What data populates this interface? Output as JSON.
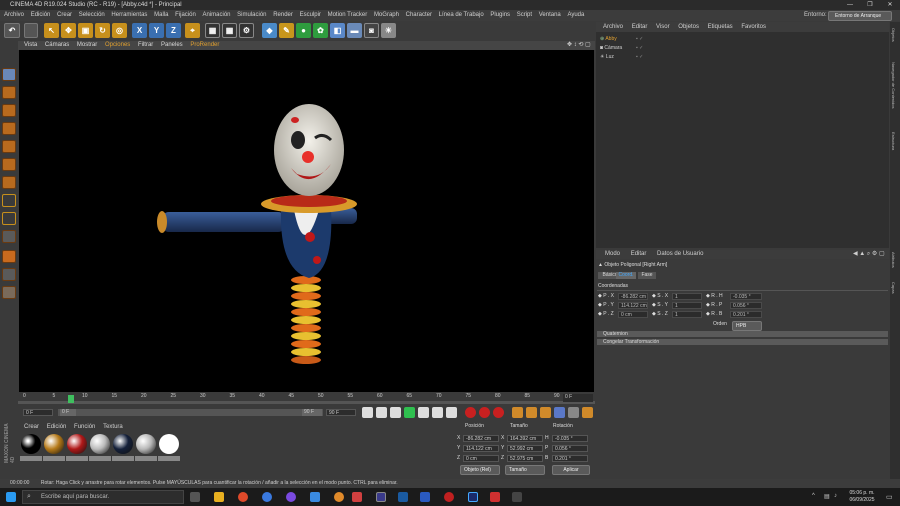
{
  "app": {
    "title": "CINEMA 4D R19.024 Studio (RC - R19) - [Abby.c4d *] - Principal",
    "window_controls": [
      "—",
      "❐",
      "✕"
    ]
  },
  "menu": [
    "Archivo",
    "Edición",
    "Crear",
    "Selección",
    "Herramientas",
    "Malla",
    "Fijación",
    "Animación",
    "Simulación",
    "Render",
    "Esculpir",
    "Motion Tracker",
    "MoGraph",
    "Character",
    "Línea de Trabajo",
    "Plugins",
    "Script",
    "Ventana",
    "Ayuda"
  ],
  "environment": {
    "label": "Entorno:",
    "value": "Entorno de Arranque"
  },
  "viewport": {
    "menu": [
      "Vista",
      "Cámaras",
      "Mostrar",
      "Opciones",
      "Filtrar",
      "Paneles",
      "ProRender"
    ]
  },
  "timeline": {
    "ticks": [
      "0",
      "5",
      "10",
      "15",
      "20",
      "25",
      "30",
      "35",
      "40",
      "45",
      "50",
      "55",
      "60",
      "65",
      "70",
      "75",
      "80",
      "85",
      "90"
    ],
    "current_frame": "0 F",
    "start": "0 F",
    "min": "0 F",
    "max": "90 F",
    "end": "90 F"
  },
  "materials": {
    "menu": [
      "Crear",
      "Edición",
      "Función",
      "Textura"
    ],
    "colors": [
      "#b67a18",
      "#b01818",
      "#bbbbbb",
      "#14203a",
      "#b8b8b8",
      "#ffffff"
    ]
  },
  "coords": {
    "headers": [
      "Posición",
      "Tamaño",
      "Rotación"
    ],
    "rows": [
      {
        "axis": "X",
        "pos": "-86.282 cm",
        "size_axis": "X",
        "size": "164.392 cm",
        "rot_axis": "H",
        "rot": "-0.035 °"
      },
      {
        "axis": "Y",
        "pos": "114.122 cm",
        "size_axis": "Y",
        "size": "52.992 cm",
        "rot_axis": "P",
        "rot": "0.056 °"
      },
      {
        "axis": "Z",
        "pos": "0 cm",
        "size_axis": "Z",
        "size": "52.975 cm",
        "rot_axis": "B",
        "rot": "0.201 °"
      }
    ],
    "mode_select": "Objeto (Rel)",
    "size_select": "Tamaño",
    "apply": "Aplicar"
  },
  "objects": {
    "menu": [
      "Archivo",
      "Editar",
      "Visor",
      "Objetos",
      "Etiquetas",
      "Favoritos"
    ],
    "items": [
      "Abby",
      "Cámara",
      "Luz"
    ]
  },
  "attributes": {
    "menu": [
      "Modo",
      "Editar",
      "Datos de Usuario"
    ],
    "object_label": "Objeto Poligonal [Right Arm]",
    "tabs": [
      "Básico",
      "Coord.",
      "Fase"
    ],
    "section": "Coordenadas",
    "rows": [
      {
        "a": "P . X",
        "av": "-86.282 cm",
        "b": "S . X",
        "bv": "1",
        "c": "R . H",
        "cv": "-0.035 °"
      },
      {
        "a": "P . Y",
        "av": "114.122 cm",
        "b": "S . Y",
        "bv": "1",
        "c": "R . P",
        "cv": "0.056 °"
      },
      {
        "a": "P . Z",
        "av": "0 cm",
        "b": "S . Z",
        "bv": "1",
        "c": "R . B",
        "cv": "0.201 °"
      }
    ],
    "order_label": "Orden",
    "order_value": "HPB",
    "collapsed": [
      "Quaternion",
      "Congelar Transformación"
    ]
  },
  "right_tabs": [
    "Objetos",
    "Navegador de Contenidos",
    "Estructura",
    "Atributos",
    "Capas"
  ],
  "status": {
    "time": "00:00:00",
    "message": "Rotar: Haga Click y arrastre para rotar elementos. Pulse MAYÚSCULAS para cuantificar la rotación / añadir a la selección en el modo punto. CTRL para eliminar."
  },
  "taskbar": {
    "search_placeholder": "Escribe aquí para buscar.",
    "time": "05:06 p. m.",
    "date": "06/09/2025"
  },
  "brand_side": "MAXON CINEMA 4D"
}
